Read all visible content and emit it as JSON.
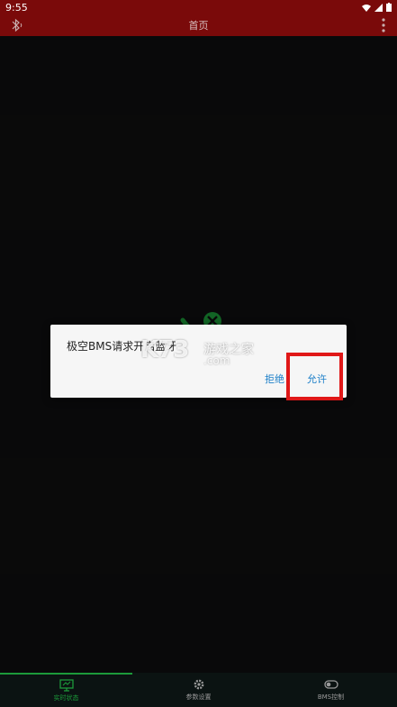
{
  "status_bar": {
    "time": "9:55",
    "icons": [
      "wifi-icon",
      "signal-icon",
      "battery-icon"
    ]
  },
  "app_bar": {
    "title": "首页",
    "left_icon": "bluetooth-icon",
    "right_icon": "more-vert-icon"
  },
  "dialog": {
    "message": "极空BMS请求开启蓝牙",
    "deny_label": "拒绝",
    "allow_label": "允许"
  },
  "watermark": {
    "logo": "K73",
    "text_cn": "游戏之家",
    "text_domain": ".com"
  },
  "bottom_nav": {
    "items": [
      {
        "label": "实时状态",
        "icon": "monitor-icon",
        "active": true
      },
      {
        "label": "参数设置",
        "icon": "gear-icon",
        "active": false
      },
      {
        "label": "BMS控制",
        "icon": "toggle-icon",
        "active": false
      }
    ]
  },
  "colors": {
    "app_bar": "#7a0a0a",
    "accent": "#1c9a3a",
    "dialog_button": "#1c7fc8",
    "highlight": "#e01818"
  }
}
